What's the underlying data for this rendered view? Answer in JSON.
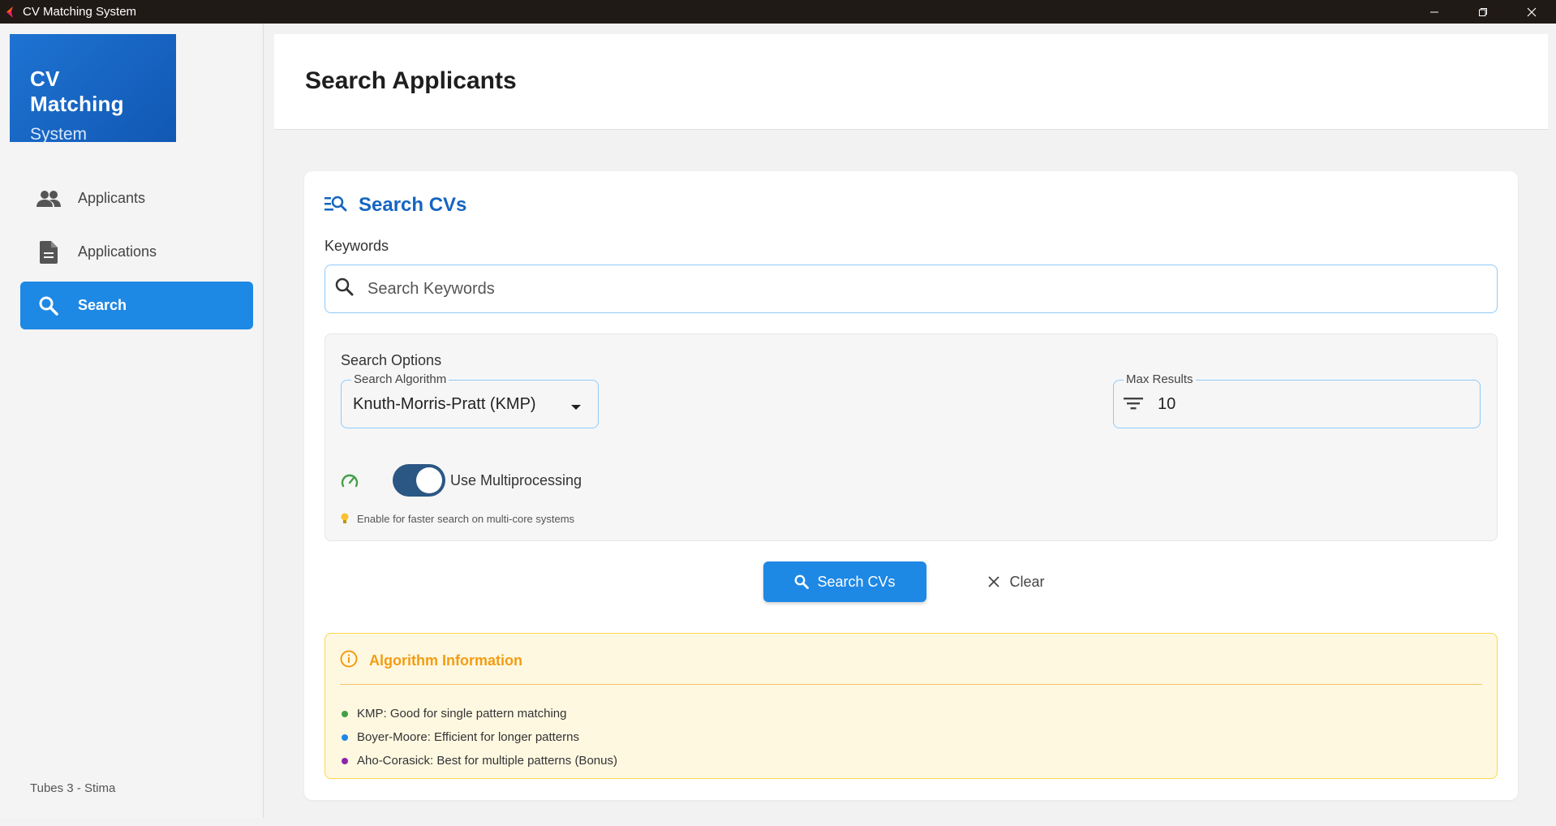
{
  "window": {
    "title": "CV Matching System"
  },
  "sidebar": {
    "brand_title": "CV Matching",
    "brand_subtitle": "System",
    "items": [
      {
        "label": "Applicants",
        "icon": "people-icon",
        "active": false
      },
      {
        "label": "Applications",
        "icon": "document-icon",
        "active": false
      },
      {
        "label": "Search",
        "icon": "search-icon",
        "active": true
      }
    ],
    "footer": "Tubes 3 - Stima"
  },
  "header": {
    "title": "Search Applicants"
  },
  "search_card": {
    "title": "Search CVs",
    "title_icon": "manage-search-icon",
    "keywords_label": "Keywords",
    "keywords_placeholder": "Search Keywords",
    "keywords_value": ""
  },
  "options": {
    "title": "Search Options",
    "algorithm_label": "Search Algorithm",
    "algorithm_value": "Knuth-Morris-Pratt (KMP)",
    "max_results_label": "Max Results",
    "max_results_value": "10",
    "multiprocessing_label": "Use Multiprocessing",
    "multiprocessing_enabled": true,
    "hint": "Enable for faster search on multi-core systems"
  },
  "actions": {
    "search_label": "Search CVs",
    "clear_label": "Clear"
  },
  "algorithm_info": {
    "title": "Algorithm Information",
    "items": [
      {
        "text": "KMP: Good for single pattern matching",
        "color": "#43a047"
      },
      {
        "text": "Boyer-Moore: Efficient for longer patterns",
        "color": "#1e88e5"
      },
      {
        "text": "Aho-Corasick: Best for multiple patterns (Bonus)",
        "color": "#8e24aa"
      }
    ]
  },
  "colors": {
    "primary": "#1e88e5",
    "brand": "#1565c0",
    "info_accent": "#f39c12",
    "toggle": "#2b5785"
  }
}
